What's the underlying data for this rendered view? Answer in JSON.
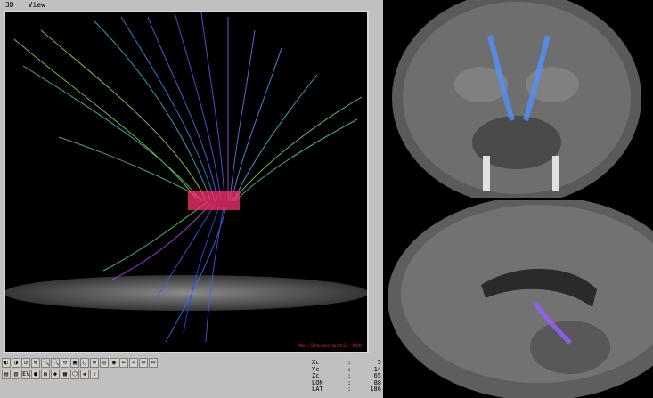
{
  "menu": {
    "item1": "3D",
    "item2": "View"
  },
  "viewer": {
    "watermark": "Max-Stereotactic-XXX"
  },
  "toolbar": {
    "row1": [
      "◐",
      "◑",
      "↺",
      "⊕",
      "🔍",
      "🔍",
      "⊖",
      "▣",
      "◯",
      "⊗",
      "◎",
      "◉",
      "←",
      "→",
      "▭",
      "▭"
    ],
    "row2": [
      "▤",
      "▥",
      "EV",
      "●",
      "◍",
      "◆",
      "▦",
      "⬡",
      "✚",
      "⇕"
    ]
  },
  "coords": [
    {
      "label": "Xc",
      "value": "5"
    },
    {
      "label": "Yc",
      "value": "14"
    },
    {
      "label": "Zc",
      "value": "65"
    },
    {
      "label": "LON",
      "value": "88"
    },
    {
      "label": "LAT",
      "value": "186"
    }
  ],
  "colors": {
    "bg": "#000000",
    "chrome": "#c0c0c0",
    "watermark": "#d02020"
  }
}
